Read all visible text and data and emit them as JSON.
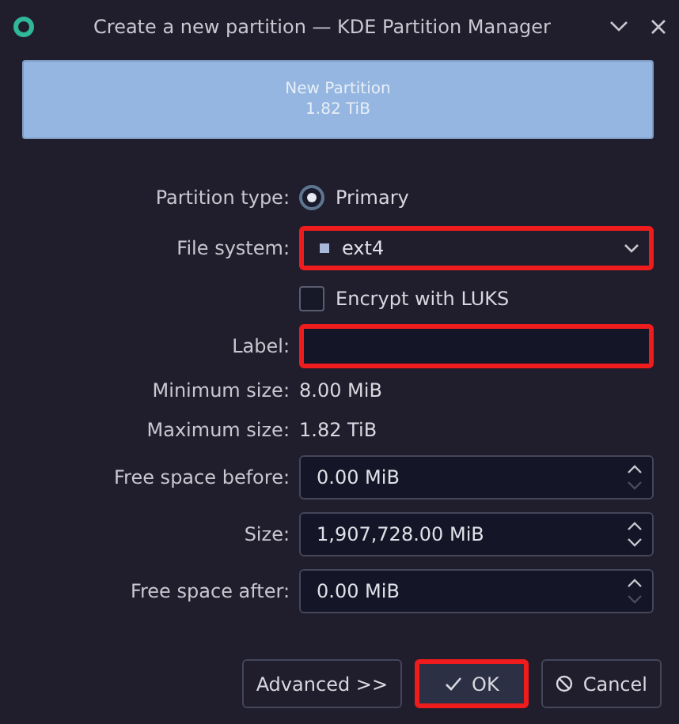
{
  "window": {
    "title": "Create a new partition — KDE Partition Manager"
  },
  "partition_bar": {
    "name": "New Partition",
    "size": "1.82 TiB"
  },
  "form": [
    {
      "kind": "radio",
      "label": "Partition type:",
      "option": "Primary",
      "selected": true
    },
    {
      "kind": "combo",
      "label": "File system:",
      "value": "ext4",
      "highlighted": true
    },
    {
      "kind": "checkbox",
      "option": "Encrypt with LUKS",
      "checked": false
    },
    {
      "kind": "text",
      "label": "Label:",
      "highlighted": true
    },
    {
      "kind": "info",
      "label": "Minimum size:",
      "value": "8.00 MiB"
    },
    {
      "kind": "info",
      "label": "Maximum size:",
      "value": "1.82 TiB"
    },
    {
      "kind": "spin",
      "label": "Free space before:",
      "value": "0.00 MiB",
      "up_enabled": true,
      "down_enabled": false
    },
    {
      "kind": "spin",
      "label": "Size:",
      "value": "1,907,728.00 MiB",
      "up_enabled": true,
      "down_enabled": true
    },
    {
      "kind": "spin",
      "label": "Free space after:",
      "value": "0.00 MiB",
      "up_enabled": true,
      "down_enabled": false
    }
  ],
  "buttons": [
    {
      "kind": "plain",
      "label": "Advanced >>",
      "highlighted": false
    },
    {
      "kind": "ok",
      "label": "OK",
      "highlighted": true
    },
    {
      "kind": "cancel",
      "label": "Cancel",
      "highlighted": false
    }
  ]
}
